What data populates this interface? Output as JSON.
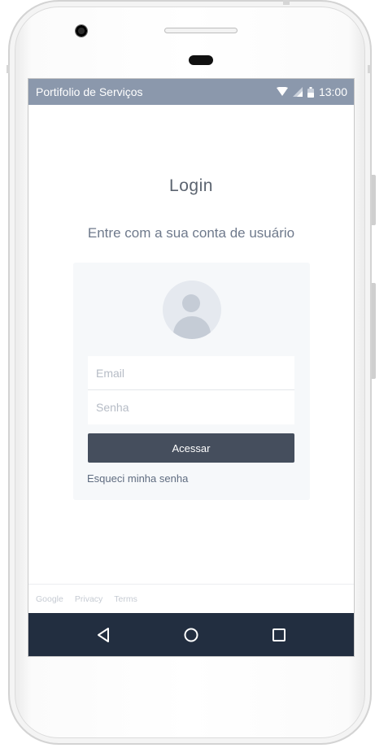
{
  "status_bar": {
    "app_title": "Portifolio de Serviços",
    "time": "13:00",
    "background_color": "#8b98ac",
    "icons": [
      "wifi-icon",
      "signal-icon",
      "battery-icon"
    ]
  },
  "login": {
    "title": "Login",
    "subtitle": "Entre com a sua conta de usuário",
    "avatar_icon": "user-avatar-icon",
    "email_placeholder": "Email",
    "password_placeholder": "Senha",
    "submit_label": "Acessar",
    "forgot_link": "Esqueci minha senha",
    "button_color": "#454e5d"
  },
  "footer": {
    "links": [
      "Google",
      "Privacy",
      "Terms"
    ]
  },
  "nav_bar": {
    "background_color": "#222e40",
    "buttons": [
      "back-icon",
      "home-icon",
      "recents-icon"
    ]
  }
}
